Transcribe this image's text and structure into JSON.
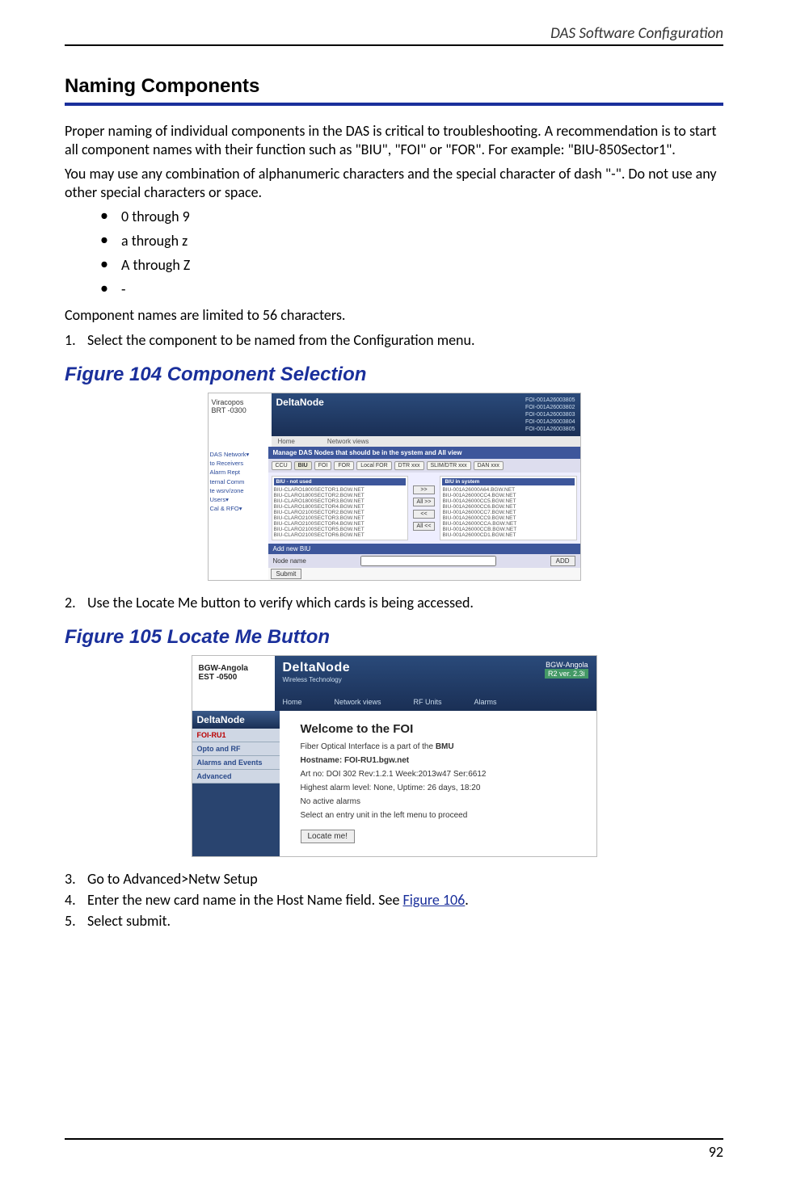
{
  "running_head": "DAS Software Configuration",
  "section_title": "Naming Components",
  "para1": "Proper naming of individual components in the DAS is critical to troubleshooting.  A recommendation is to start all component names with their function such as \"BIU\", \"FOI\" or \"FOR\".  For example: \"BIU-850Sector1\".",
  "para2": "You may use any combination of alphanumeric characters and the special character of dash \"-\".  Do not use any other special characters or space.",
  "chars": [
    "0 through 9",
    "a through z",
    "A through Z",
    "-"
  ],
  "para3": "Component names are limited to 56 characters.",
  "steps": {
    "s1": {
      "n": "1.",
      "t": "Select the component to be named from the Configuration menu."
    },
    "s2": {
      "n": "2.",
      "t": "Use the Locate Me button to verify which cards is being accessed."
    },
    "s3": {
      "n": "3.",
      "t": "Go to Advanced>Netw Setup"
    },
    "s4a": {
      "n": "4.",
      "t": "Enter the new card name in the Host Name field. See "
    },
    "s4link": "Figure  106",
    "s4b": ".",
    "s5": {
      "n": "5.",
      "t": "Select submit."
    }
  },
  "fig104": {
    "caption": "Figure 104    Component Selection"
  },
  "fig105": {
    "caption": "Figure 105    Locate Me Button"
  },
  "ss1": {
    "model_a": "Viracopos",
    "model_b": "BRT -0300",
    "logo": "DeltaNode",
    "links": [
      "FOI-001A26003805",
      "FOI-001A26003802",
      "FOI-001A26003803",
      "FOI-001A26003804",
      "FOI-001A26003805"
    ],
    "tabs": [
      "Home",
      "Network views"
    ],
    "bluebar": "Manage DAS Nodes that should be in the system and All view",
    "chips": [
      "CCU",
      "BIU",
      "FOI",
      "FOR",
      "Local FOR",
      "DTR xxx",
      "SLIM/DTR xxx",
      "DAN xxx"
    ],
    "left_hdr": "BIU - not used",
    "right_hdr": "BIU in system",
    "left_items": [
      "BIU-CLARO1800SECTOR1.BGW.NET",
      "BIU-CLARO1800SECTOR2.BGW.NET",
      "BIU-CLARO1800SECTOR3.BGW.NET",
      "BIU-CLARO1800SECTOR4.BGW.NET",
      "BIU-CLARO2100SECTOR2.BGW.NET",
      "BIU-CLARO2100SECTOR3.BGW.NET",
      "BIU-CLARO2100SECTOR4.BGW.NET",
      "BIU-CLARO2100SECTOR5.BGW.NET",
      "BIU-CLARO2100SECTOR6.BGW.NET"
    ],
    "right_items": [
      "BIU-001A26000A64.BGW.NET",
      "BIU-001A26000CC4.BGW.NET",
      "BIU-001A26000CC5.BGW.NET",
      "BIU-001A26000CC6.BGW.NET",
      "BIU-001A26000CC7.BGW.NET",
      "BIU-001A26000CC9.BGW.NET",
      "BIU-001A26000CCA.BGW.NET",
      "BIU-001A26000CCB.BGW.NET",
      "BIU-001A26000CD1.BGW.NET"
    ],
    "midbtns": [
      ">>",
      "All >>",
      "<<",
      "All <<"
    ],
    "leftnav": [
      "DAS Network▾",
      "to Receivers",
      "Alarm Rept",
      "ternal Comm",
      "te wsrv/zone",
      "Users▾",
      "Cal & RFO▾"
    ],
    "addbar": "Add new BIU",
    "nodelabel": "Node name",
    "add": "ADD",
    "submit": "Submit"
  },
  "ss2": {
    "est_a": "BGW-Angola",
    "est_b": "EST -0500",
    "logo": "DeltaNode",
    "sub": "Wireless  Technology",
    "right_a": "BGW-Angola",
    "right_b": "R2 ver. 2.3i",
    "nav": [
      "Home",
      "Network views",
      "RF Units",
      "Alarms"
    ],
    "side_logo": "DeltaNode",
    "side_items": [
      "FOI-RU1",
      "Opto and RF",
      "Alarms and Events",
      "Advanced"
    ],
    "welcome": "Welcome to the FOI",
    "l1a": "Fiber Optical Interface is a part of the ",
    "l1b": "BMU",
    "l2": "Hostname: FOI-RU1.bgw.net",
    "l3": "Art no: DOI 302 Rev:1.2.1 Week:2013w47 Ser:6612",
    "l4": "Highest alarm level: None,  Uptime: 26 days, 18:20",
    "l5": "No active alarms",
    "l6": "Select an entry unit in the left menu to proceed",
    "btn": "Locate me!"
  },
  "page_num": "92"
}
